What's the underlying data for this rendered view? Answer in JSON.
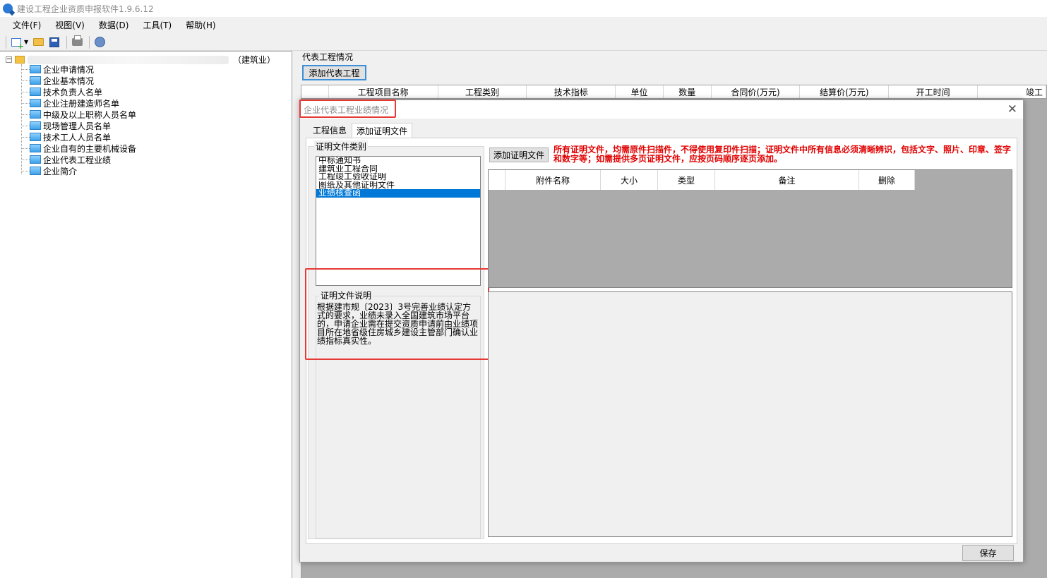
{
  "window": {
    "title": "建设工程企业资质申报软件1.9.6.12"
  },
  "menu": [
    "文件(F)",
    "视图(V)",
    "数据(D)",
    "工具(T)",
    "帮助(H)"
  ],
  "toolbar": {
    "icons": [
      "new-icon",
      "open-folder-icon",
      "save-icon",
      "print-icon",
      "help-icon"
    ]
  },
  "tree": {
    "root_suffix": "（建筑业）",
    "items": [
      "企业申请情况",
      "企业基本情况",
      "技术负责人名单",
      "企业注册建造师名单",
      "中级及以上职称人员名单",
      "现场管理人员名单",
      "技术工人人员名单",
      "企业自有的主要机械设备",
      "企业代表工程业绩",
      "企业简介"
    ]
  },
  "right_panel": {
    "group_title": "代表工程情况",
    "add_button": "添加代表工程",
    "columns": [
      "工程项目名称",
      "工程类别",
      "技术指标",
      "单位",
      "数量",
      "合同价(万元)",
      "结算价(万元)",
      "开工时间",
      "竣工"
    ]
  },
  "dialog": {
    "title": "企业代表工程业绩情况",
    "tabs": [
      "工程信息",
      "添加证明文件"
    ],
    "active_tab": "添加证明文件",
    "category_label": "证明文件类别",
    "categories": [
      "中标通知书",
      "建筑业工程合同",
      "工程竣工验收证明",
      "图纸及其他证明文件",
      "业绩核查函"
    ],
    "selected_category": "业绩核查函",
    "desc_label": "证明文件说明",
    "desc_text": "根据建市规〔2023〕3号完善业绩认定方式的要求，业绩未录入全国建筑市场平台的，申请企业需在提交资质申请前由业绩项目所在地省级住房城乡建设主管部门确认业绩指标真实性。",
    "add_cert_button": "添加证明文件",
    "warning": "所有证明文件，均需原件扫描件，不得使用复印件扫描；证明文件中所有信息必须清晰辨识，包括文字、照片、印章、签字和数字等；如需提供多页证明文件，应按页码顺序逐页添加。",
    "attachment_columns": [
      "附件名称",
      "大小",
      "类型",
      "备注",
      "删除"
    ],
    "save_button": "保存"
  },
  "colors": {
    "highlight_red": "#e53935",
    "warning_red": "#e00000",
    "selection_blue": "#0078d7",
    "grid_gray": "#ababab"
  }
}
